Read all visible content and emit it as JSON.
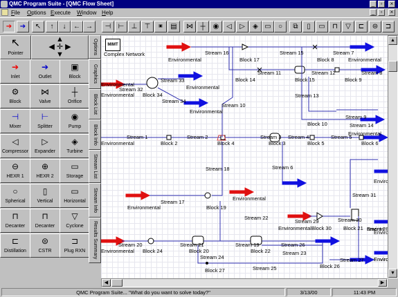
{
  "window": {
    "title": "QMC Program Suite - [QMC Flow Sheet]"
  },
  "menu": [
    "File",
    "Options",
    "Execute",
    "Window",
    "Help"
  ],
  "palette": {
    "pointer_label": "Pointer",
    "items": [
      {
        "label": "Inlet",
        "icon": "inlet-arrow"
      },
      {
        "label": "Outlet",
        "icon": "outlet-arrow"
      },
      {
        "label": "Block",
        "icon": "mimt-block"
      },
      {
        "label": "Block",
        "icon": "block-group"
      },
      {
        "label": "Valve",
        "icon": "valve"
      },
      {
        "label": "Orifice",
        "icon": "orifice"
      },
      {
        "label": "Mixer",
        "icon": "mixer"
      },
      {
        "label": "Splitter",
        "icon": "splitter"
      },
      {
        "label": "Pump",
        "icon": "pump"
      },
      {
        "label": "Compressor",
        "icon": "compressor"
      },
      {
        "label": "Expander",
        "icon": "expander"
      },
      {
        "label": "Turbine",
        "icon": "turbine"
      },
      {
        "label": "HEXR 1",
        "icon": "hexr1"
      },
      {
        "label": "HEXR 2",
        "icon": "hexr2"
      },
      {
        "label": "Storage",
        "icon": "storage"
      },
      {
        "label": "Spherical",
        "icon": "spherical"
      },
      {
        "label": "Vertical",
        "icon": "vertical"
      },
      {
        "label": "Horizontal",
        "icon": "horizontal"
      },
      {
        "label": "Decanter",
        "icon": "decanter"
      },
      {
        "label": "Decanter",
        "icon": "decanter"
      },
      {
        "label": "Cyclone",
        "icon": "cyclone"
      },
      {
        "label": "Distillation",
        "icon": "distillation"
      },
      {
        "label": "CSTR",
        "icon": "cstr"
      },
      {
        "label": "Plug RXN",
        "icon": "plug-rxn"
      }
    ]
  },
  "tabs": [
    "Options",
    "Graphics",
    "Block List",
    "Block Info",
    "Stream List",
    "Stream Info",
    "Results Summary"
  ],
  "flowsheet": {
    "logo": "MIMT",
    "logo_caption": "Complex Network",
    "labels": [
      "Stream 16",
      "Stream 15",
      "Stream 7",
      "Block 17",
      "Block 8",
      "Environmental",
      "Environmental",
      "Stream 11",
      "Stream 12",
      "Stream 8",
      "Block 14",
      "Block 15",
      "Block 9",
      "Environmental",
      "Stream 33",
      "Stream 32",
      "Environmental",
      "Block 34",
      "Environmental",
      "Stream 34",
      "Stream 10",
      "Environmental",
      "Stream 13",
      "Stream 9",
      "Environmental",
      "Block 10",
      "Stream 14",
      "Stream 1",
      "Stream 2",
      "Stream 3",
      "Stream 4",
      "Stream 5",
      "Environmental",
      "Block 2",
      "Block 4",
      "Block 3",
      "Block 5",
      "Block 6",
      "Stream 6",
      "Stream 18",
      "Environmental",
      "Environmental",
      "Stream 17",
      "Block 19",
      "Environmental",
      "Environmental",
      "Stream 31",
      "Stream 22",
      "Stream 29",
      "Environmental",
      "Block 30",
      "Stream 30",
      "Block 21",
      "Environ",
      "nment 28",
      "Environ",
      "Stream 20",
      "Stream 21",
      "Stream 19",
      "Stream 26",
      "Environmental",
      "Block 24",
      "Block 20",
      "Block 22",
      "Stream 23",
      "Stream 24",
      "Stream 27",
      "Stream 25",
      "Block 27",
      "Block 26",
      "Environ"
    ]
  },
  "status": {
    "message": "QMC Program Suite... \"What do you want to solve today?\"",
    "date": "3/13/00",
    "time": "11:43 PM"
  }
}
